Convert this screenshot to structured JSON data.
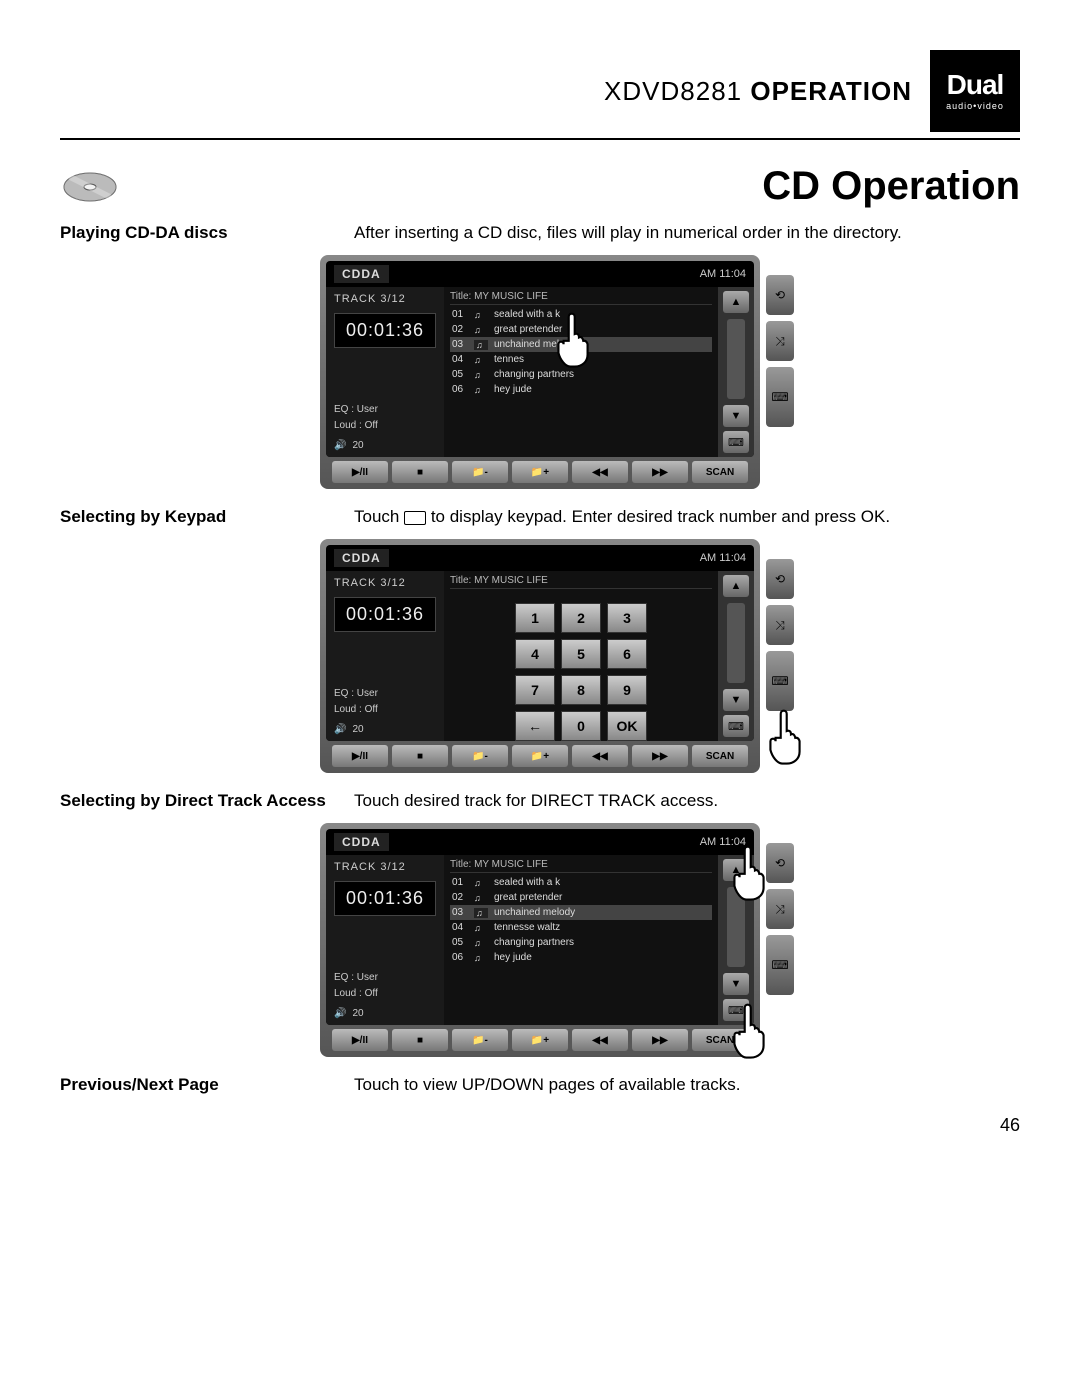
{
  "header": {
    "model": "XDVD8281",
    "section": "OPERATION",
    "brand": "Dual",
    "sub": "audio•video"
  },
  "title": "CD Operation",
  "rows": {
    "r1_label": "Playing CD-DA discs",
    "r1_desc": "After inserting a CD disc, files will play in numerical order in the directory.",
    "r2_label": "Selecting by Keypad",
    "r2_desc_a": "Touch ",
    "r2_desc_b": " to display keypad. Enter desired track number and press OK.",
    "r3_label": "Selecting by Direct Track Access",
    "r3_desc": "Touch desired track for DIRECT TRACK access.",
    "r4_label": "Previous/Next Page",
    "r4_desc": "Touch to view UP/DOWN pages of available tracks."
  },
  "screen": {
    "mode": "CDDA",
    "clock": "AM 11:04",
    "track_label": "TRACK  3/12",
    "time": "00:01:36",
    "eq_label": "EQ",
    "eq_value": ": User",
    "loud_label": "Loud",
    "loud_value": ": Off",
    "vol": "20",
    "title": "Title: MY  MUSIC LIFE",
    "tracks": [
      {
        "n": "01",
        "name": "sealed with a k"
      },
      {
        "n": "02",
        "name": "great pretender"
      },
      {
        "n": "03",
        "name": "unchained melody"
      },
      {
        "n": "04",
        "name": "tennesse waltz"
      },
      {
        "n": "05",
        "name": "changing partners"
      },
      {
        "n": "06",
        "name": "hey jude"
      }
    ],
    "tracks_alt3": "tennes",
    "keypad": [
      "1",
      "2",
      "3",
      "4",
      "5",
      "6",
      "7",
      "8",
      "9",
      "←",
      "0",
      "OK"
    ],
    "bottom": [
      "▶/II",
      "■",
      "📁-",
      "📁+",
      "◀◀",
      "▶▶",
      "SCAN"
    ]
  },
  "page_num": "46"
}
